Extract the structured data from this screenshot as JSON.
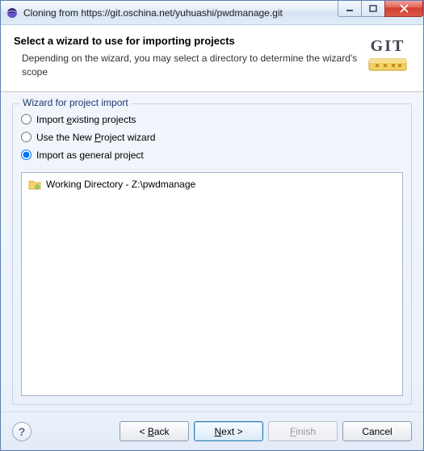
{
  "titlebar": {
    "text": "Cloning from https://git.oschina.net/yuhuashi/pwdmanage.git"
  },
  "header": {
    "title": "Select a wizard to use for importing projects",
    "description": "Depending on the wizard, you may select a directory to determine the wizard's scope",
    "logo_text": "GIT"
  },
  "group": {
    "legend": "Wizard for project import",
    "options": {
      "existing": {
        "pre": "Import ",
        "key": "e",
        "post": "xisting projects",
        "checked": false
      },
      "newproj": {
        "pre": "Use the New ",
        "key": "P",
        "post": "roject wizard",
        "checked": false
      },
      "general": {
        "pre": "Import as ",
        "key": "g",
        "post": "eneral project",
        "checked": true
      }
    }
  },
  "list": {
    "items": [
      {
        "label": "Working Directory - Z:\\pwdmanage"
      }
    ]
  },
  "buttons": {
    "help": "?",
    "back_pre": "< ",
    "back_key": "B",
    "back_post": "ack",
    "next_pre": "",
    "next_key": "N",
    "next_post": "ext >",
    "finish_pre": "",
    "finish_key": "F",
    "finish_post": "inish",
    "cancel": "Cancel"
  }
}
